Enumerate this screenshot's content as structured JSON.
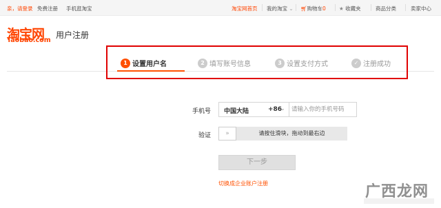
{
  "topbar": {
    "greeting": "亲，请登录",
    "free_register": "免费注册",
    "mobile_taobao": "手机逛淘宝",
    "home": "淘宝网首页",
    "my_taobao": "我的淘宝",
    "cart": "购物车",
    "cart_count": "0",
    "favorites": "收藏夹",
    "categories": "商品分类",
    "seller_center": "卖家中心"
  },
  "logo": {
    "cn": "淘宝网",
    "en": "Taobao.com"
  },
  "page_title": "用户注册",
  "steps": [
    {
      "num": "1",
      "label": "设置用户名"
    },
    {
      "num": "2",
      "label": "填写账号信息"
    },
    {
      "num": "3",
      "label": "设置支付方式"
    },
    {
      "num": "✓",
      "label": "注册成功"
    }
  ],
  "form": {
    "phone_label": "手机号",
    "region_name": "中国大陆",
    "region_code": "+86",
    "phone_placeholder": "请输入你的手机号码",
    "verify_label": "验证",
    "slider_handle": "»",
    "slider_text": "请按住滑块，拖动到最右边",
    "next_button": "下一步",
    "switch_link": "切换成企业账户注册"
  },
  "watermark": {
    "text": "广西龙网"
  },
  "colors": {
    "accent": "#ff5000",
    "highlight_box": "#e00000"
  }
}
